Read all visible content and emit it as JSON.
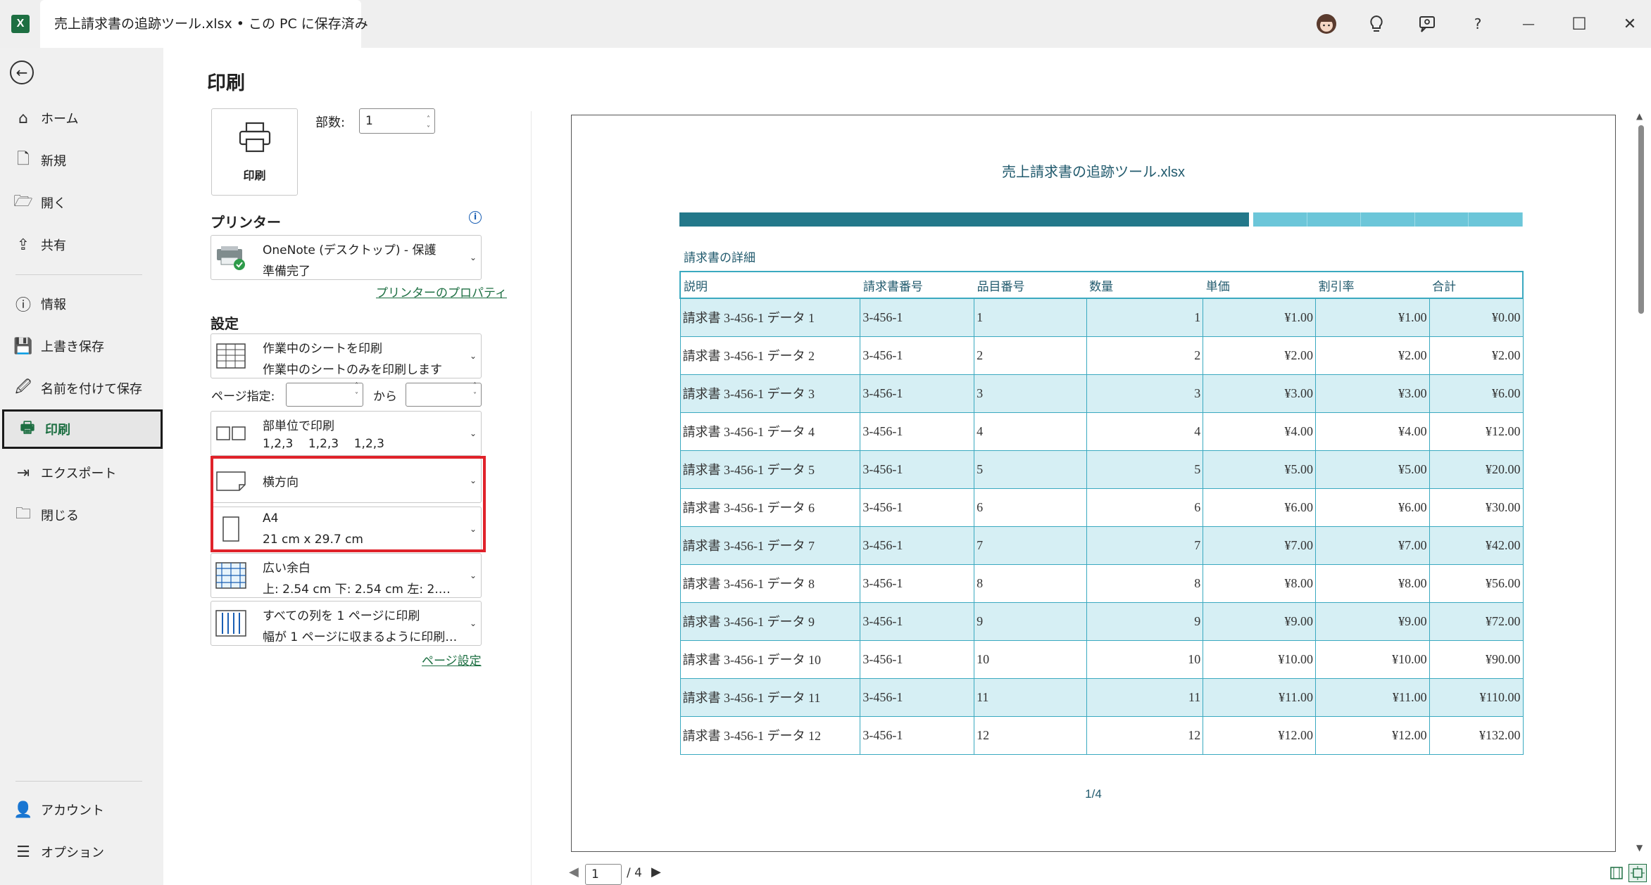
{
  "app": {
    "title": "売上請求書の追跡ツール.xlsx",
    "save_status": " • この PC に保存済み",
    "logo_letter": "X"
  },
  "titlebar_icons": [
    "avatar-icon",
    "lightbulb-icon",
    "feedback-icon",
    "help-icon",
    "minimize-icon",
    "maximize-icon",
    "close-icon"
  ],
  "titlebar_glyphs": {
    "help": "?",
    "minimize": "—",
    "maximize": "☐",
    "close": "✕"
  },
  "nav": {
    "back": "←",
    "items": [
      {
        "label": "ホーム",
        "icon": "⌂"
      },
      {
        "label": "新規",
        "icon": "🗋"
      },
      {
        "label": "開く",
        "icon": "🗁"
      },
      {
        "label": "共有",
        "icon": "⇪"
      },
      {
        "label": "情報",
        "icon": "ⓘ"
      },
      {
        "label": "上書き保存",
        "icon": "💾"
      },
      {
        "label": "名前を付けて保存",
        "icon": "🖉"
      },
      {
        "label": "印刷",
        "icon": "🖶"
      },
      {
        "label": "エクスポート",
        "icon": "⇥"
      },
      {
        "label": "閉じる",
        "icon": "🗀"
      }
    ],
    "bottom": [
      {
        "label": "アカウント",
        "icon": "👤"
      },
      {
        "label": "オプション",
        "icon": "☰"
      }
    ]
  },
  "print": {
    "page_title": "印刷",
    "print_button": "印刷",
    "copies_label": "部数:",
    "copies_value": "1",
    "printer_heading": "プリンター",
    "printer_name": "OneNote (デスクトップ) - 保護",
    "printer_status": "準備完了",
    "printer_properties": "プリンターのプロパティ",
    "settings_heading": "設定",
    "what_title": "作業中のシートを印刷",
    "what_sub": "作業中のシートのみを印刷します",
    "pages_label": "ページ指定:",
    "pages_to": "から",
    "collate_title": "部単位で印刷",
    "collate_sub": "1,2,3    1,2,3    1,2,3",
    "orientation": "横方向",
    "paper_title": "A4",
    "paper_sub": "21 cm x 29.7 cm",
    "margins_title": "広い余白",
    "margins_sub": "上: 2.54 cm 下: 2.54 cm 左: 2.…",
    "scaling_title": "すべての列を 1 ページに印刷",
    "scaling_sub": "幅が 1 ページに収まるように印刷イメ…",
    "page_setup": "ページ設定"
  },
  "preview": {
    "doc_title": "売上請求書の追跡ツール.xlsx",
    "table_caption": "請求書の詳細",
    "columns": [
      "説明",
      "請求書番号",
      "品目番号",
      "数量",
      "単価",
      "割引率",
      "合計"
    ],
    "rows": [
      [
        "請求書 3-456-1 データ 1",
        "3-456-1",
        "1",
        "1",
        "¥1.00",
        "¥1.00",
        "¥0.00"
      ],
      [
        "請求書 3-456-1 データ 2",
        "3-456-1",
        "2",
        "2",
        "¥2.00",
        "¥2.00",
        "¥2.00"
      ],
      [
        "請求書 3-456-1 データ 3",
        "3-456-1",
        "3",
        "3",
        "¥3.00",
        "¥3.00",
        "¥6.00"
      ],
      [
        "請求書 3-456-1 データ 4",
        "3-456-1",
        "4",
        "4",
        "¥4.00",
        "¥4.00",
        "¥12.00"
      ],
      [
        "請求書 3-456-1 データ 5",
        "3-456-1",
        "5",
        "5",
        "¥5.00",
        "¥5.00",
        "¥20.00"
      ],
      [
        "請求書 3-456-1 データ 6",
        "3-456-1",
        "6",
        "6",
        "¥6.00",
        "¥6.00",
        "¥30.00"
      ],
      [
        "請求書 3-456-1 データ 7",
        "3-456-1",
        "7",
        "7",
        "¥7.00",
        "¥7.00",
        "¥42.00"
      ],
      [
        "請求書 3-456-1 データ 8",
        "3-456-1",
        "8",
        "8",
        "¥8.00",
        "¥8.00",
        "¥56.00"
      ],
      [
        "請求書 3-456-1 データ 9",
        "3-456-1",
        "9",
        "9",
        "¥9.00",
        "¥9.00",
        "¥72.00"
      ],
      [
        "請求書 3-456-1 データ 10",
        "3-456-1",
        "10",
        "10",
        "¥10.00",
        "¥10.00",
        "¥90.00"
      ],
      [
        "請求書 3-456-1 データ 11",
        "3-456-1",
        "11",
        "11",
        "¥11.00",
        "¥11.00",
        "¥110.00"
      ],
      [
        "請求書 3-456-1 データ 12",
        "3-456-1",
        "12",
        "12",
        "¥12.00",
        "¥12.00",
        "¥132.00"
      ]
    ],
    "page_footer": "1/4",
    "current_page": "1",
    "total_pages": "/ 4"
  },
  "colors": {
    "accent": "#1d6f42",
    "table_border": "#3aa9c0",
    "band_dark": "#23788a",
    "band_light": "#6cc6d9",
    "row_fill": "#d6eff4",
    "highlight": "#e0222a"
  }
}
